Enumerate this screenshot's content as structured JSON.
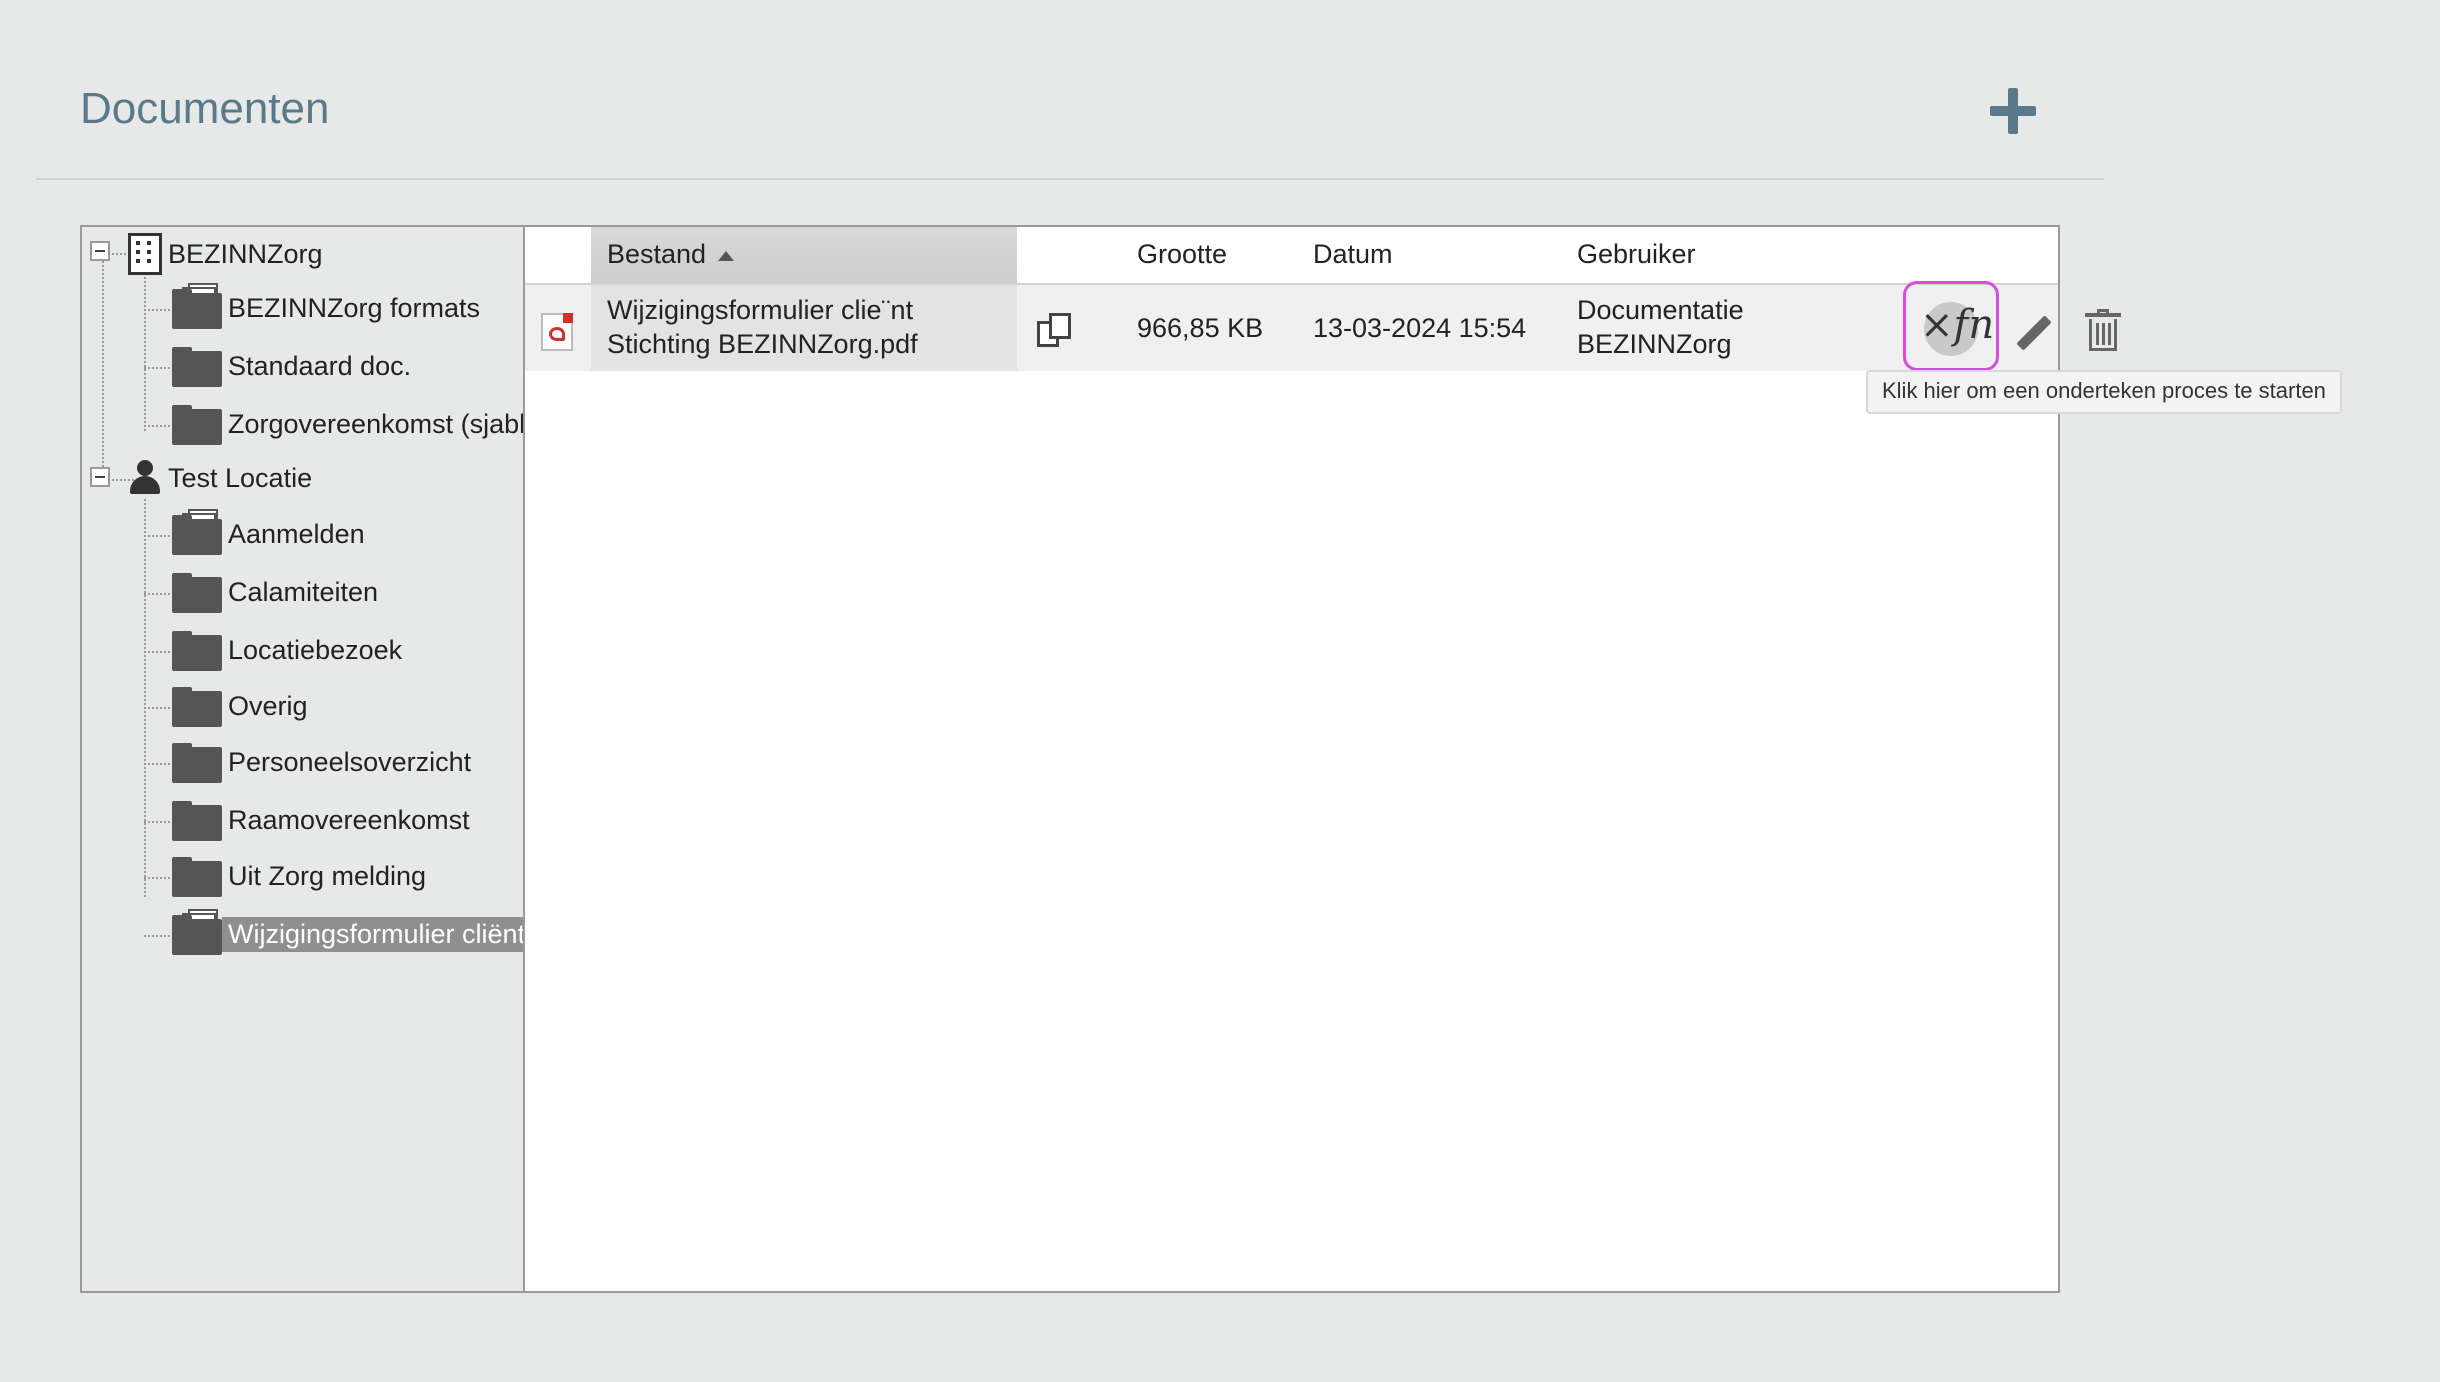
{
  "header": {
    "title": "Documenten",
    "add_icon": "plus-icon"
  },
  "tree": {
    "groups": [
      {
        "label": "BEZINNZorg",
        "icon": "building-icon",
        "children": [
          {
            "label": "BEZINNZorg formats"
          },
          {
            "label": "Standaard doc."
          },
          {
            "label": "Zorgovereenkomst (sjabl"
          }
        ]
      },
      {
        "label": "Test Locatie",
        "icon": "person-icon",
        "children": [
          {
            "label": "Aanmelden"
          },
          {
            "label": "Calamiteiten"
          },
          {
            "label": "Locatiebezoek"
          },
          {
            "label": "Overig"
          },
          {
            "label": "Personeelsoverzicht"
          },
          {
            "label": "Raamovereenkomst"
          },
          {
            "label": "Uit Zorg melding"
          },
          {
            "label": "Wijzigingsformulier cliënt",
            "selected": true
          }
        ]
      }
    ]
  },
  "grid": {
    "columns": {
      "file": "Bestand",
      "size": "Grootte",
      "date": "Datum",
      "user": "Gebruiker"
    },
    "rows": [
      {
        "file_line1": "Wijzigingsformulier clie¨nt",
        "file_line2": "Stichting BEZINNZorg.pdf",
        "size": "966,85 KB",
        "date": "13-03-2024 15:54",
        "user_line1": "Documentatie",
        "user_line2": "BEZINNZorg"
      }
    ]
  },
  "tooltip": "Klik hier om een onderteken proces te starten",
  "colors": {
    "accent": "#5a7a8c",
    "highlight": "#d24fe0",
    "selected": "#8f8f8f"
  }
}
